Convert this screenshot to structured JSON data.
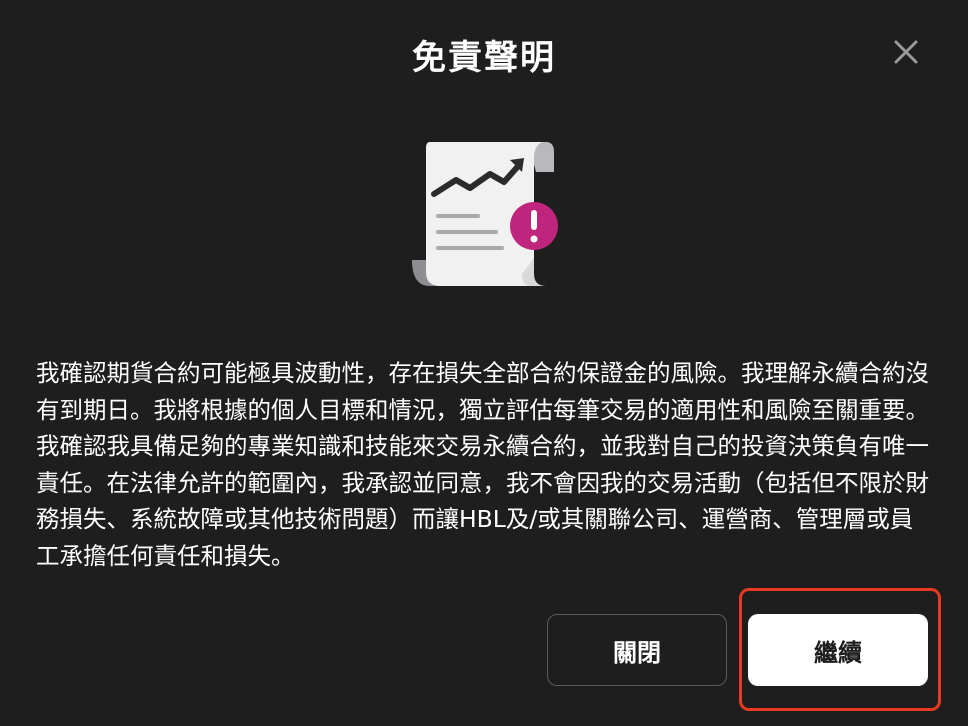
{
  "dialog": {
    "title": "免責聲明",
    "close_icon": "close-icon",
    "illustration_icon": "document-chart-warning-icon",
    "body": "我確認期貨合約可能極具波動性，存在損失全部合約保證金的風險。我理解永續合約沒有到期日。我將根據的個人目標和情況，獨立評估每筆交易的適用性和風險至關重要。我確認我具備足夠的專業知識和技能來交易永續合約，並我對自己的投資決策負有唯一責任。在法律允許的範圍內，我承認並同意，我不會因我的交易活動（包括但不限於財務損失、系統故障或其他技術問題）而讓HBL及/或其關聯公司、運營商、管理層或員工承擔任何責任和損失。",
    "buttons": {
      "close_label": "關閉",
      "continue_label": "繼續"
    }
  },
  "colors": {
    "background": "#1e1e1f",
    "accent_warning": "#c0257d",
    "highlight": "#e83a23"
  }
}
